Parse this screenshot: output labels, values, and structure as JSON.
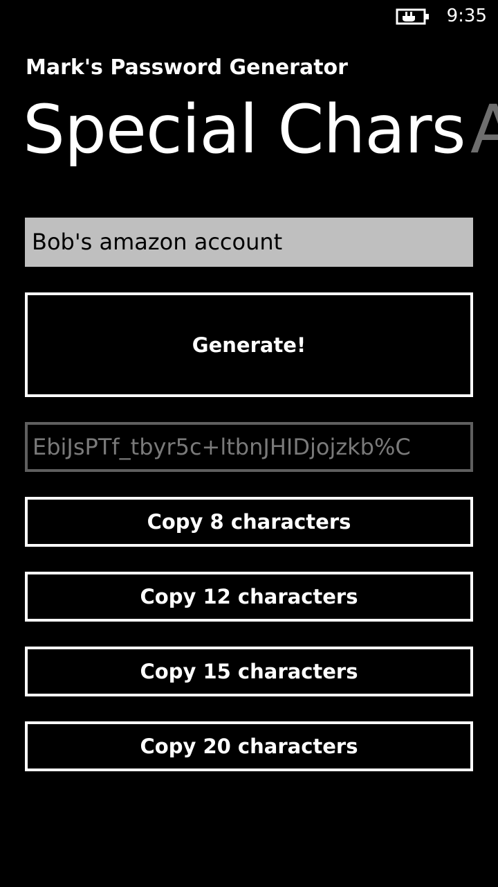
{
  "status_bar": {
    "time": "9:35",
    "battery_icon": "battery-charging-icon"
  },
  "app": {
    "title": "Mark's Password Generator"
  },
  "pivot": {
    "current": "Special Chars",
    "next_peek": "A"
  },
  "form": {
    "account_value": "Bob's amazon account",
    "generate_label": "Generate!",
    "password_value": "EbiJsPTf_tbyr5c+ltbnJHIDjojzkb%C"
  },
  "copy_buttons": [
    {
      "label": "Copy 8 characters"
    },
    {
      "label": "Copy 12 characters"
    },
    {
      "label": "Copy 15 characters"
    },
    {
      "label": "Copy 20 characters"
    }
  ],
  "colors": {
    "background": "#000000",
    "foreground": "#ffffff",
    "input_background": "#bfbfbf",
    "disabled_border": "#5f5f5f",
    "disabled_text": "#7a7a7a"
  }
}
